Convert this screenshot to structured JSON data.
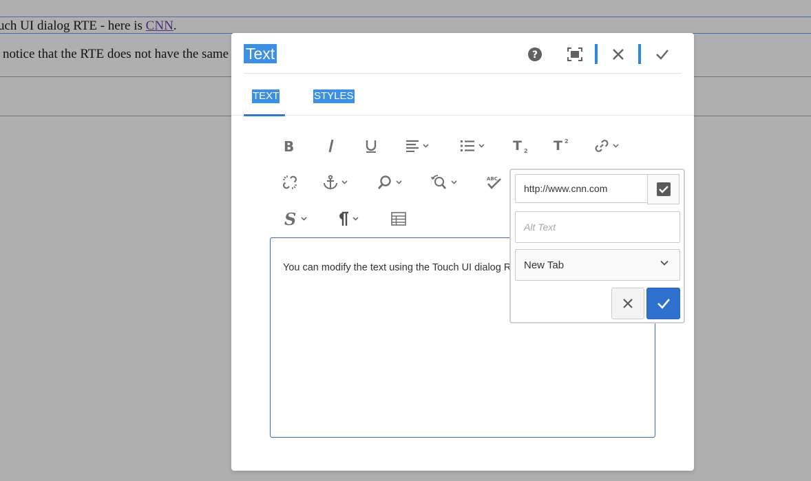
{
  "background": {
    "line1_prefix": "uch UI dialog RTE - here is ",
    "line1_link": "CNN",
    "line1_suffix": ".",
    "line2": "notice that the RTE does not have the same"
  },
  "dialog": {
    "title": "Text",
    "header_buttons": [
      "help-icon",
      "fullscreen-icon",
      "close-icon",
      "done-icon"
    ],
    "tabs": [
      {
        "label": "TEXT",
        "active": true
      },
      {
        "label": "STYLES",
        "active": false
      }
    ]
  },
  "toolbar": {
    "row1": [
      "bold",
      "italic",
      "underline",
      "justify (dropdown)",
      "list (dropdown)",
      "subscript",
      "superscript",
      "link (dropdown)"
    ],
    "row2": [
      "unlink",
      "anchor (dropdown)",
      "find (dropdown)",
      "find-replace (dropdown)",
      "spellcheck"
    ],
    "row3": [
      "styles (dropdown)",
      "paragraph-format (dropdown)",
      "table"
    ]
  },
  "editor": {
    "content": "You can modify the text using the Touch UI dialog RT"
  },
  "link_popover": {
    "url_value": "http://www.cnn.com",
    "alt_text_placeholder": "Alt Text",
    "target_value": "New Tab"
  },
  "colors": {
    "accent": "#2b88e0",
    "selection": "#3b8fe4",
    "primary_button": "#2f6fce",
    "icon": "#6e6e6e",
    "background": "#afafaf"
  }
}
